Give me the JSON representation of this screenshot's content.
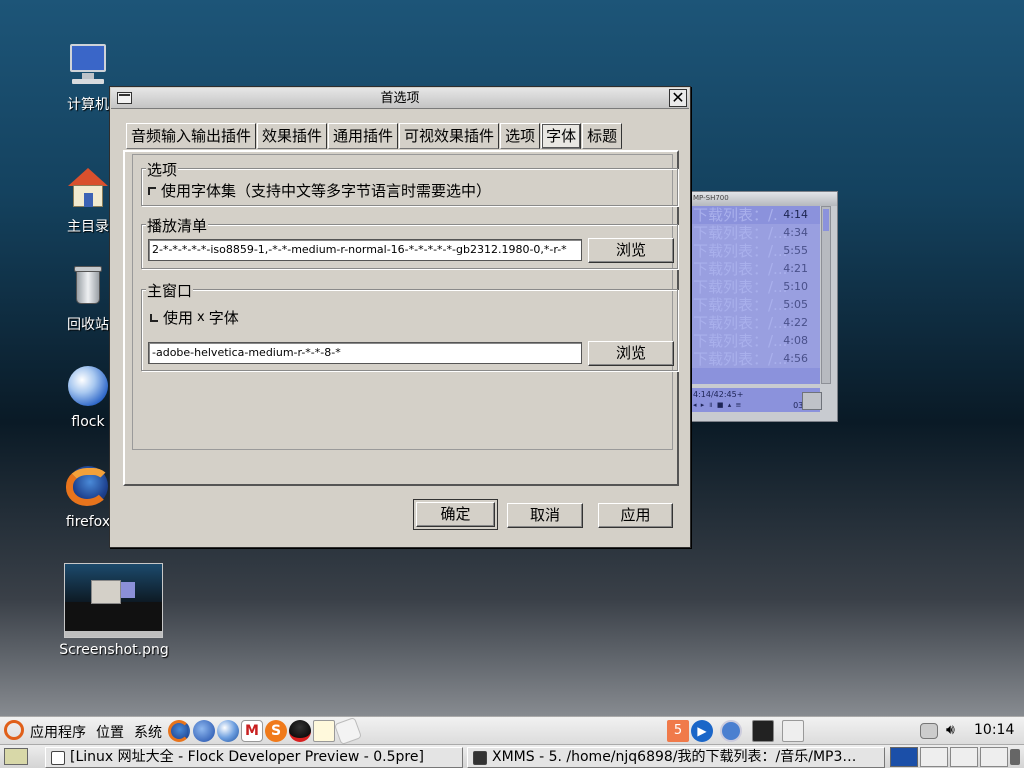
{
  "desktop": {
    "icons": [
      {
        "label": "计算机"
      },
      {
        "label": "主目录"
      },
      {
        "label": "回收站"
      },
      {
        "label": "flock"
      },
      {
        "label": "firefox"
      },
      {
        "label": "Screenshot.png"
      }
    ]
  },
  "xmms_playlist": {
    "title": "MP-SH700",
    "rows": [
      {
        "text": "下载列表：/.",
        "time": "4:14"
      },
      {
        "text": "下载列表：/...",
        "time": "4:34"
      },
      {
        "text": "下载列表：/...",
        "time": "5:55"
      },
      {
        "text": "下载列表：/...",
        "time": "4:21"
      },
      {
        "text": "下载列表：/...",
        "time": "5:10"
      },
      {
        "text": "下载列表：/...",
        "time": "5:05"
      },
      {
        "text": "下载列表：/...",
        "time": "4:22"
      },
      {
        "text": "下载列表：/...",
        "time": "4:08"
      },
      {
        "text": "下载列表：/...",
        "time": "4:56"
      }
    ],
    "footer_info": "4:14/42:45+",
    "footer_time": "03 42"
  },
  "dialog": {
    "title": "首选项",
    "close_glyph": "✕",
    "tabs": [
      {
        "label": "音频输入输出插件"
      },
      {
        "label": "效果插件"
      },
      {
        "label": "通用插件"
      },
      {
        "label": "可视效果插件"
      },
      {
        "label": "选项"
      },
      {
        "label": "字体"
      },
      {
        "label": "标题"
      }
    ],
    "options_group": {
      "label": "选项",
      "fontset_checkbox": "使用字体集（支持中文等多字节语言时需要选中）"
    },
    "playlist_group": {
      "label": "播放清单",
      "font_value": "2-*-*-*-*-*-iso8859-1,-*-*-medium-r-normal-16-*-*-*-*-*-gb2312.1980-0,*-r-*",
      "browse": "浏览"
    },
    "mainwindow_group": {
      "label": "主窗口",
      "use_x_font_pre": "使用",
      "use_x_font_x": "x",
      "use_x_font_post": "字体",
      "font_value": "-adobe-helvetica-medium-r-*-*-8-*",
      "browse": "浏览"
    },
    "buttons": {
      "ok": "确定",
      "cancel": "取消",
      "apply": "应用"
    }
  },
  "top_panel": {
    "menu_apps": "应用程序",
    "menu_places": "位置",
    "menu_system": "系统",
    "clock": "10:14"
  },
  "bottom_panel": {
    "tasks": [
      {
        "label": "[Linux 网址大全 - Flock Developer Preview - 0.5pre]"
      },
      {
        "label": "XMMS - 5. /home/njq6898/我的下载列表：/音乐/MP3…"
      }
    ]
  },
  "colors": {
    "dialog_bg": "#d4d0c8",
    "xmms_list": "#8b92dc",
    "desktop_top": "#1d5578"
  }
}
